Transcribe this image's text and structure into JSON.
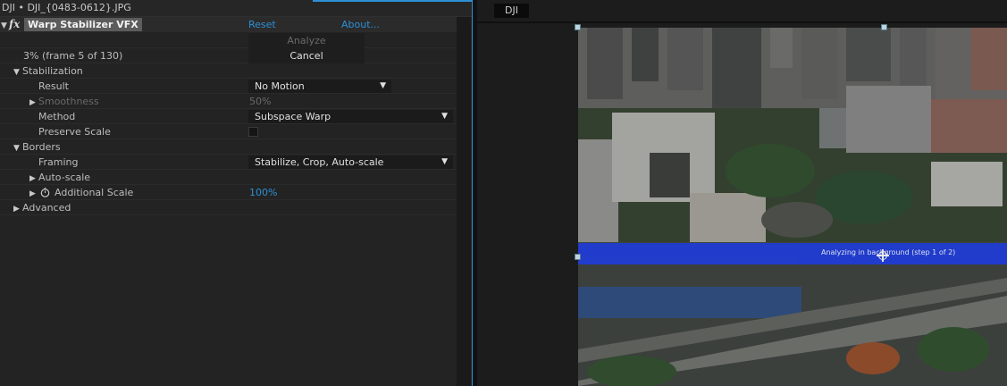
{
  "panel": {
    "header_title": "DJI • DJI_{0483-0612}.JPG"
  },
  "effect": {
    "fx_symbol": "fx",
    "name": "Warp Stabilizer VFX",
    "reset_label": "Reset",
    "about_label": "About...",
    "analyze_label": "Analyze",
    "progress_text": "3% (frame 5 of 130)",
    "cancel_label": "Cancel"
  },
  "stabilization": {
    "group_label": "Stabilization",
    "result_label": "Result",
    "result_value": "No Motion",
    "smoothness_label": "Smoothness",
    "smoothness_value": "50%",
    "method_label": "Method",
    "method_value": "Subspace Warp",
    "preserve_scale_label": "Preserve Scale",
    "preserve_scale_checked": false
  },
  "borders": {
    "group_label": "Borders",
    "framing_label": "Framing",
    "framing_value": "Stabilize, Crop, Auto-scale",
    "autoscale_label": "Auto-scale",
    "additional_scale_label": "Additional Scale",
    "additional_scale_value": "100%"
  },
  "advanced": {
    "group_label": "Advanced"
  },
  "viewer": {
    "tab_label": "DJI",
    "status_text": "Analyzing in background (step 1 of 2)"
  },
  "colors": {
    "accent": "#2d8fd6",
    "analysis_band": "#1f3bd8"
  },
  "icons": {
    "expand": "triangle-right",
    "collapse": "triangle-down",
    "stopwatch": "stopwatch-icon",
    "dropdown": "chevron-down-icon"
  }
}
